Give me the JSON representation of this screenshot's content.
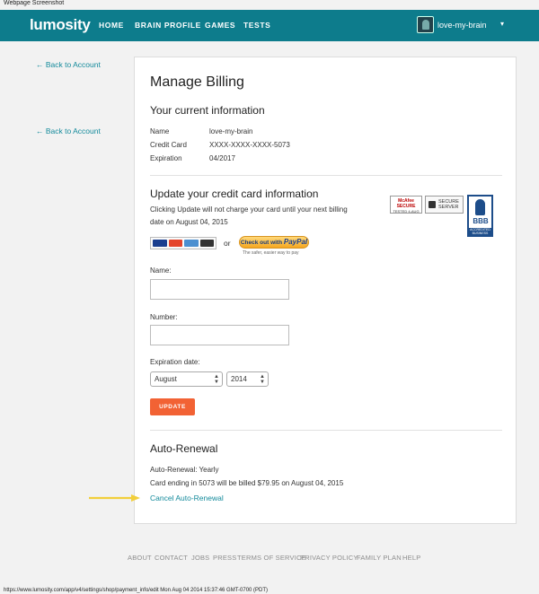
{
  "window_caption": "Webpage Screenshot",
  "nav": {
    "logo": "lumosity",
    "items": [
      "HOME",
      "BRAIN PROFILE",
      "GAMES",
      "TESTS"
    ],
    "username": "love-my-brain",
    "caret": "▾"
  },
  "back_link": "← Back to Account",
  "billing": {
    "title": "Manage Billing",
    "current_heading": "Your current information",
    "rows": [
      {
        "label": "Name",
        "value": "love-my-brain"
      },
      {
        "label": "Credit Card",
        "value": "XXXX-XXXX-XXXX-5073"
      },
      {
        "label": "Expiration",
        "value": "04/2017"
      }
    ],
    "update_heading": "Update your credit card information",
    "update_note_line1": "Clicking Update will not charge your card until your next billing",
    "update_note_line2": "date on August 04, 2015",
    "or_text": "or",
    "paypal_small": "Check out with",
    "paypal_brand": "PayPal",
    "paypal_sub": "The safer, easier way to pay",
    "mcafee": "McAfee SECURE",
    "mcafee_sub": "TESTED 4-AUG",
    "secure_server": "SECURE SERVER",
    "bbb": "BBB",
    "bbb_accredited": "ACCREDITED BUSINESS",
    "name_label": "Name:",
    "number_label": "Number:",
    "expiration_label": "Expiration date:",
    "month_value": "August",
    "year_value": "2014",
    "update_button": "UPDATE",
    "auto_heading": "Auto-Renewal",
    "auto_status": "Auto-Renewal: Yearly",
    "auto_bill": "Card ending in 5073 will be billed $79.95 on August 04, 2015",
    "cancel_link": "Cancel Auto-Renewal"
  },
  "footer": [
    "ABOUT",
    "CONTACT",
    "JOBS",
    "PRESS",
    "TERMS OF SERVICE",
    "PRIVACY POLICY",
    "FAMILY PLAN",
    "HELP"
  ],
  "status_url": "https://www.lumosity.com/app/v4/settings/shop/payment_info/edit Mon Aug 04 2014 15:37:46 GMT-0700 (PDT)",
  "colors": {
    "nav": "#0d7c8c",
    "link": "#138a9b",
    "button": "#f26234",
    "arrow": "#f2cf3b"
  }
}
